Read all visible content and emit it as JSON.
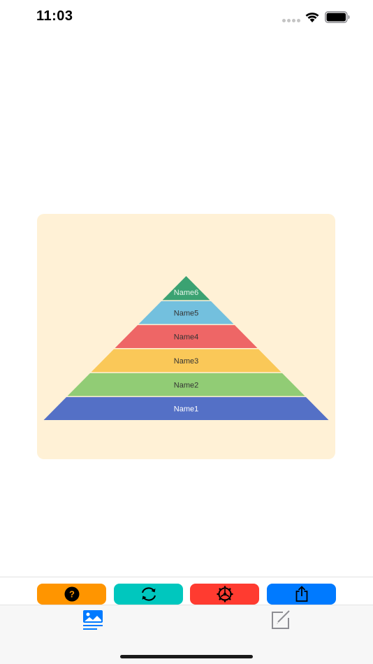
{
  "status_bar": {
    "time": "11:03"
  },
  "chart_data": {
    "type": "pyramid",
    "levels": [
      {
        "name": "Name1",
        "color": "#5470c6",
        "label_color": "#ffffff"
      },
      {
        "name": "Name2",
        "color": "#91cc75",
        "label_color": "#333333"
      },
      {
        "name": "Name3",
        "color": "#fac858",
        "label_color": "#333333"
      },
      {
        "name": "Name4",
        "color": "#ee6666",
        "label_color": "#333333"
      },
      {
        "name": "Name5",
        "color": "#73c0de",
        "label_color": "#333333"
      },
      {
        "name": "Name6",
        "color": "#3ba272",
        "label_color": "#e6f5ea"
      }
    ],
    "background": "#fff1d6"
  },
  "toolbar": {
    "buttons": [
      {
        "name": "help",
        "icon": "question-circle-icon",
        "color": "#ff9500"
      },
      {
        "name": "refresh",
        "icon": "refresh-arrows-icon",
        "color": "#00c7be"
      },
      {
        "name": "settings",
        "icon": "gear-icon",
        "color": "#ff3b30"
      },
      {
        "name": "share",
        "icon": "share-icon",
        "color": "#007aff"
      }
    ]
  },
  "tab_bar": {
    "tabs": [
      {
        "name": "gallery",
        "icon": "picture-list-icon",
        "active": true,
        "color": "#007aff"
      },
      {
        "name": "edit",
        "icon": "compose-icon",
        "active": false,
        "color": "#8e8e93"
      }
    ]
  }
}
